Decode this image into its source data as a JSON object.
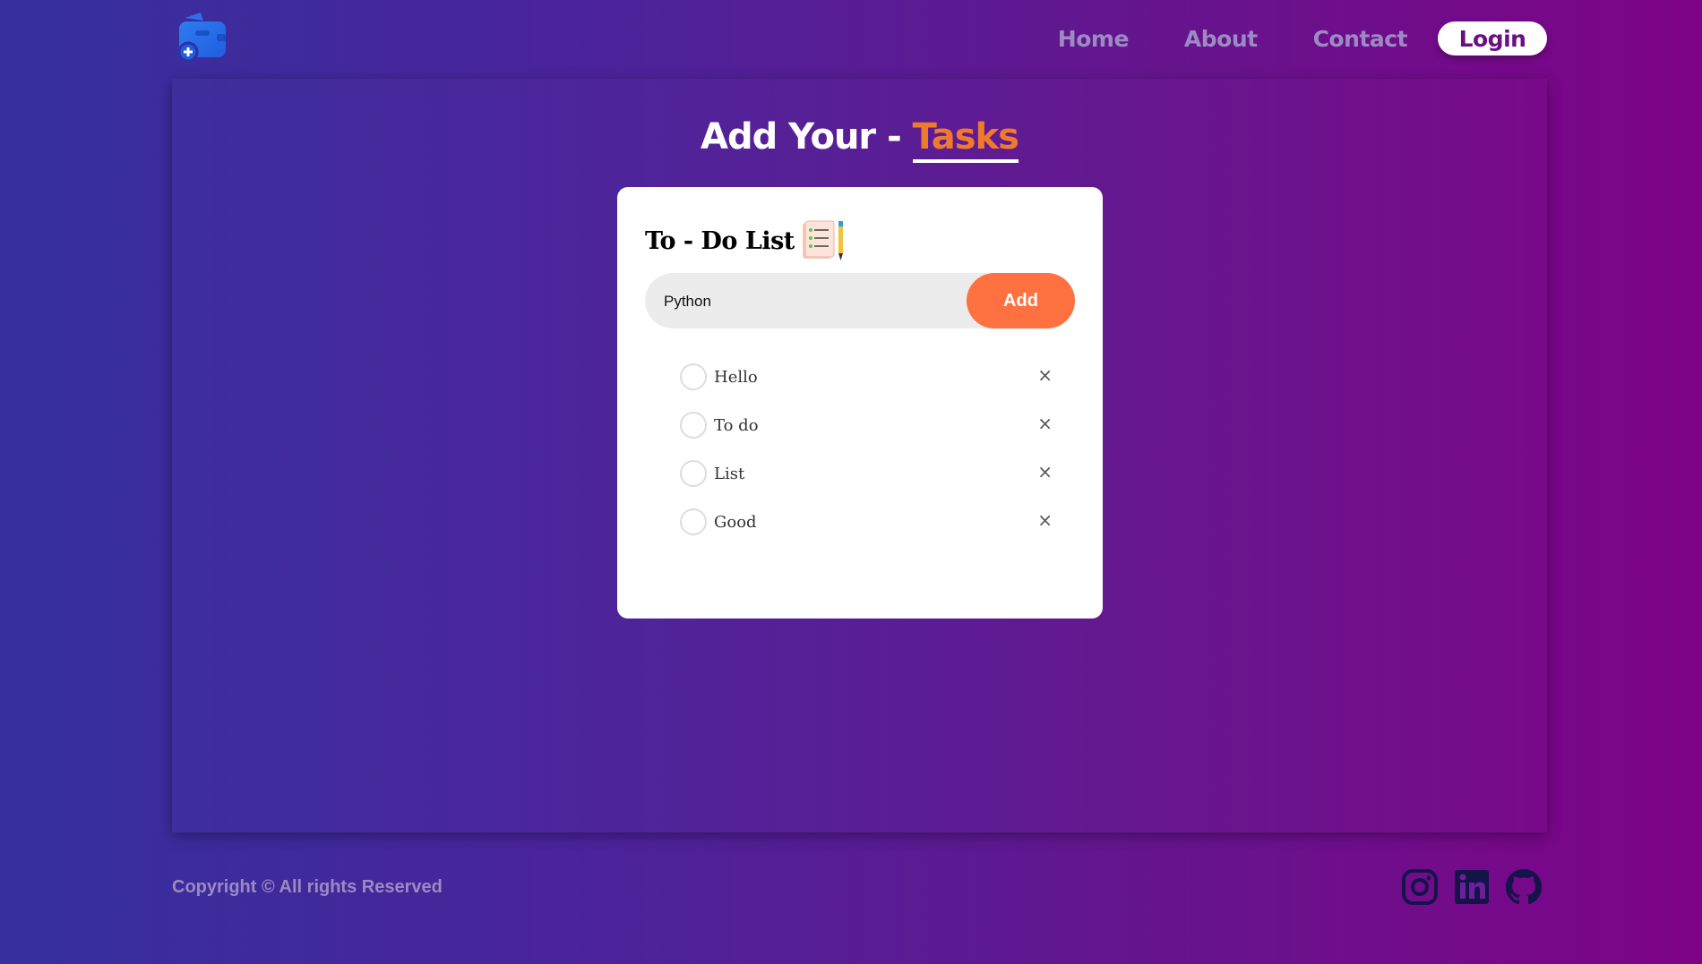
{
  "nav": {
    "links": [
      "Home",
      "About",
      "Contact"
    ],
    "login_label": "Login"
  },
  "page_title": {
    "prefix": "Add Your - ",
    "accent": "Tasks"
  },
  "todo": {
    "title": "To - Do List",
    "input_value": "Python",
    "add_label": "Add",
    "remove_glyph": "×",
    "tasks": [
      "Hello",
      "To do",
      "List",
      "Good"
    ]
  },
  "footer": {
    "copyright": "Copyright © All rights Reserved",
    "social_icons": [
      "instagram-icon",
      "linkedin-icon",
      "github-icon"
    ]
  },
  "colors": {
    "accent": "#ef7a2e",
    "add_button": "#ff7140",
    "nav_text": "#9c8ac2",
    "brand_purple": "#6b0f84"
  }
}
